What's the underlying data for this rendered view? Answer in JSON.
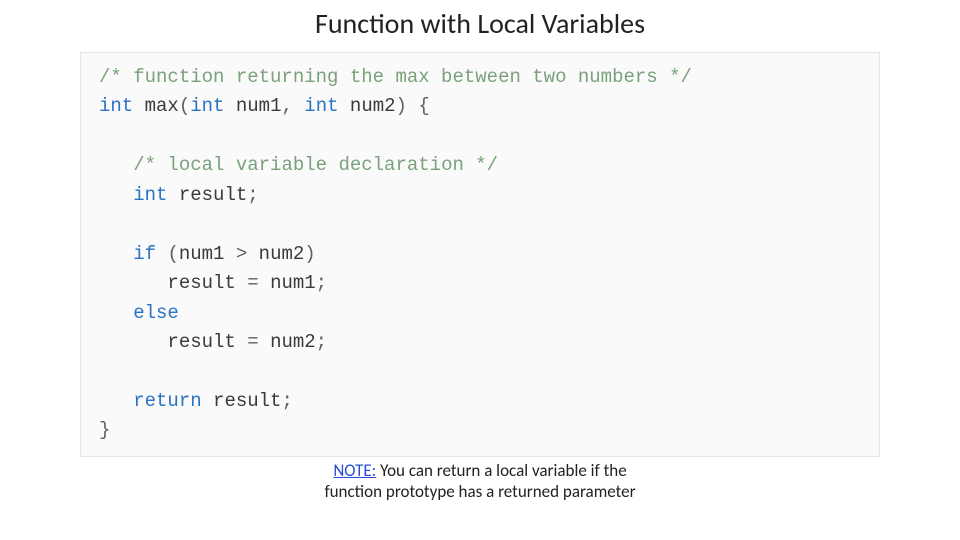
{
  "title": "Function with Local Variables",
  "code": {
    "tokens": [
      [
        {
          "cls": "tok-comment",
          "t": "/* function returning the max between two numbers */"
        }
      ],
      [
        {
          "cls": "tok-type",
          "t": "int"
        },
        {
          "cls": "",
          "t": " "
        },
        {
          "cls": "tok-fn",
          "t": "max"
        },
        {
          "cls": "tok-punc",
          "t": "("
        },
        {
          "cls": "tok-type",
          "t": "int"
        },
        {
          "cls": "",
          "t": " "
        },
        {
          "cls": "tok-param",
          "t": "num1"
        },
        {
          "cls": "tok-punc",
          "t": ","
        },
        {
          "cls": "",
          "t": " "
        },
        {
          "cls": "tok-type",
          "t": "int"
        },
        {
          "cls": "",
          "t": " "
        },
        {
          "cls": "tok-param",
          "t": "num2"
        },
        {
          "cls": "tok-punc",
          "t": ")"
        },
        {
          "cls": "",
          "t": " "
        },
        {
          "cls": "tok-punc",
          "t": "{"
        }
      ],
      [
        {
          "cls": "",
          "t": ""
        }
      ],
      [
        {
          "cls": "",
          "t": "   "
        },
        {
          "cls": "tok-comment",
          "t": "/* local variable declaration */"
        }
      ],
      [
        {
          "cls": "",
          "t": "   "
        },
        {
          "cls": "tok-type",
          "t": "int"
        },
        {
          "cls": "",
          "t": " "
        },
        {
          "cls": "tok-id",
          "t": "result"
        },
        {
          "cls": "tok-punc",
          "t": ";"
        }
      ],
      [
        {
          "cls": "",
          "t": ""
        }
      ],
      [
        {
          "cls": "",
          "t": "   "
        },
        {
          "cls": "tok-kw",
          "t": "if"
        },
        {
          "cls": "",
          "t": " "
        },
        {
          "cls": "tok-punc",
          "t": "("
        },
        {
          "cls": "tok-id",
          "t": "num1"
        },
        {
          "cls": "",
          "t": " "
        },
        {
          "cls": "tok-op",
          "t": ">"
        },
        {
          "cls": "",
          "t": " "
        },
        {
          "cls": "tok-id",
          "t": "num2"
        },
        {
          "cls": "tok-punc",
          "t": ")"
        }
      ],
      [
        {
          "cls": "",
          "t": "      "
        },
        {
          "cls": "tok-id",
          "t": "result"
        },
        {
          "cls": "",
          "t": " "
        },
        {
          "cls": "tok-op",
          "t": "="
        },
        {
          "cls": "",
          "t": " "
        },
        {
          "cls": "tok-id",
          "t": "num1"
        },
        {
          "cls": "tok-punc",
          "t": ";"
        }
      ],
      [
        {
          "cls": "",
          "t": "   "
        },
        {
          "cls": "tok-kw",
          "t": "else"
        }
      ],
      [
        {
          "cls": "",
          "t": "      "
        },
        {
          "cls": "tok-id",
          "t": "result"
        },
        {
          "cls": "",
          "t": " "
        },
        {
          "cls": "tok-op",
          "t": "="
        },
        {
          "cls": "",
          "t": " "
        },
        {
          "cls": "tok-id",
          "t": "num2"
        },
        {
          "cls": "tok-punc",
          "t": ";"
        }
      ],
      [
        {
          "cls": "",
          "t": ""
        }
      ],
      [
        {
          "cls": "",
          "t": "   "
        },
        {
          "cls": "tok-kw",
          "t": "return"
        },
        {
          "cls": "",
          "t": " "
        },
        {
          "cls": "tok-id",
          "t": "result"
        },
        {
          "cls": "tok-punc",
          "t": ";"
        }
      ],
      [
        {
          "cls": "tok-punc",
          "t": "}"
        }
      ]
    ]
  },
  "note": {
    "label": "NOTE:",
    "line1": " You can return a local variable if the",
    "line2": "function prototype has a returned parameter"
  }
}
